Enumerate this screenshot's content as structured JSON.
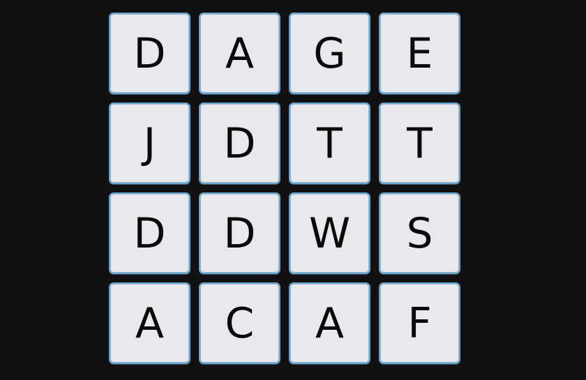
{
  "board": {
    "tiles": [
      {
        "letter": "D"
      },
      {
        "letter": "A"
      },
      {
        "letter": "G"
      },
      {
        "letter": "E"
      },
      {
        "letter": "J"
      },
      {
        "letter": "D"
      },
      {
        "letter": "T"
      },
      {
        "letter": "T"
      },
      {
        "letter": "D"
      },
      {
        "letter": "D"
      },
      {
        "letter": "W"
      },
      {
        "letter": "S"
      },
      {
        "letter": "A"
      },
      {
        "letter": "C"
      },
      {
        "letter": "A"
      },
      {
        "letter": "F"
      }
    ]
  },
  "colors": {
    "background": "#121010",
    "tile": "#e8e8ed",
    "tile_border": "#6aa6cf",
    "letter": "#0a0a0a"
  }
}
